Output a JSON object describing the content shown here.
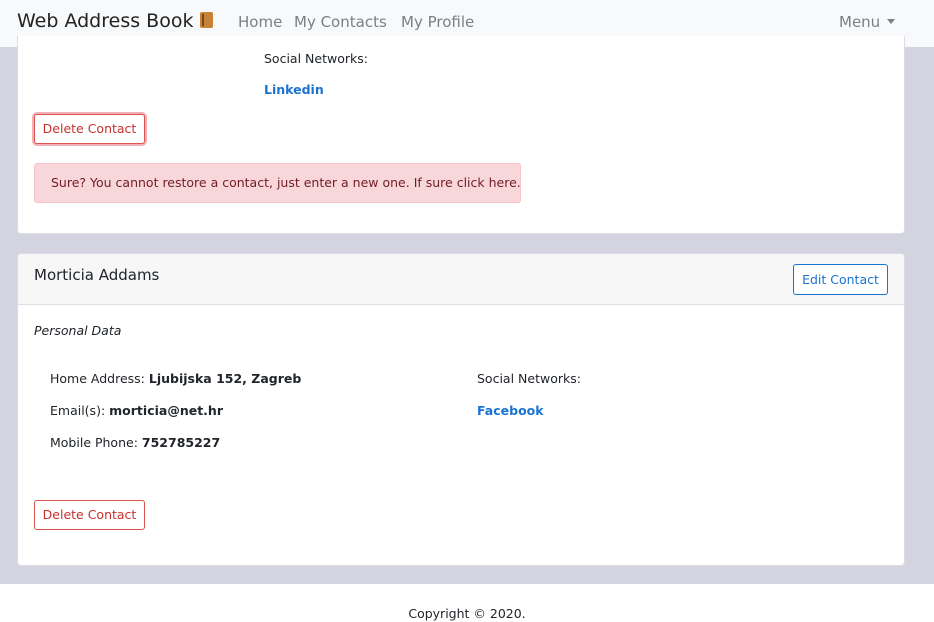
{
  "navbar": {
    "brand": "Web Address Book",
    "brand_icon": "book-icon",
    "links": [
      {
        "label": "Home"
      },
      {
        "label": "My Contacts"
      },
      {
        "label": "My Profile"
      }
    ],
    "menu_label": "Menu"
  },
  "contact_1": {
    "social_label": "Social Networks:",
    "social_links": [
      "Linkedin"
    ],
    "delete_label": "Delete Contact",
    "confirm_alert": "Sure? You cannot restore a contact, just enter a new one. If sure click here."
  },
  "contact_2": {
    "name": "Morticia Addams",
    "edit_label": "Edit Contact",
    "section_label": "Personal Data",
    "home_address_label": "Home Address:",
    "home_address": "Ljubijska 152, Zagreb",
    "email_label": "Email(s):",
    "email": "morticia@net.hr",
    "mobile_label": "Mobile Phone:",
    "mobile": "752785227",
    "social_label": "Social Networks:",
    "social_links": [
      "Facebook"
    ],
    "delete_label": "Delete Contact"
  },
  "footer": {
    "copyright": "Copyright © 2020."
  },
  "colors": {
    "page_bg": "#d4d4e0",
    "link": "#1a73d1",
    "danger": "#c9302c",
    "alert_bg": "#f8d7da"
  }
}
